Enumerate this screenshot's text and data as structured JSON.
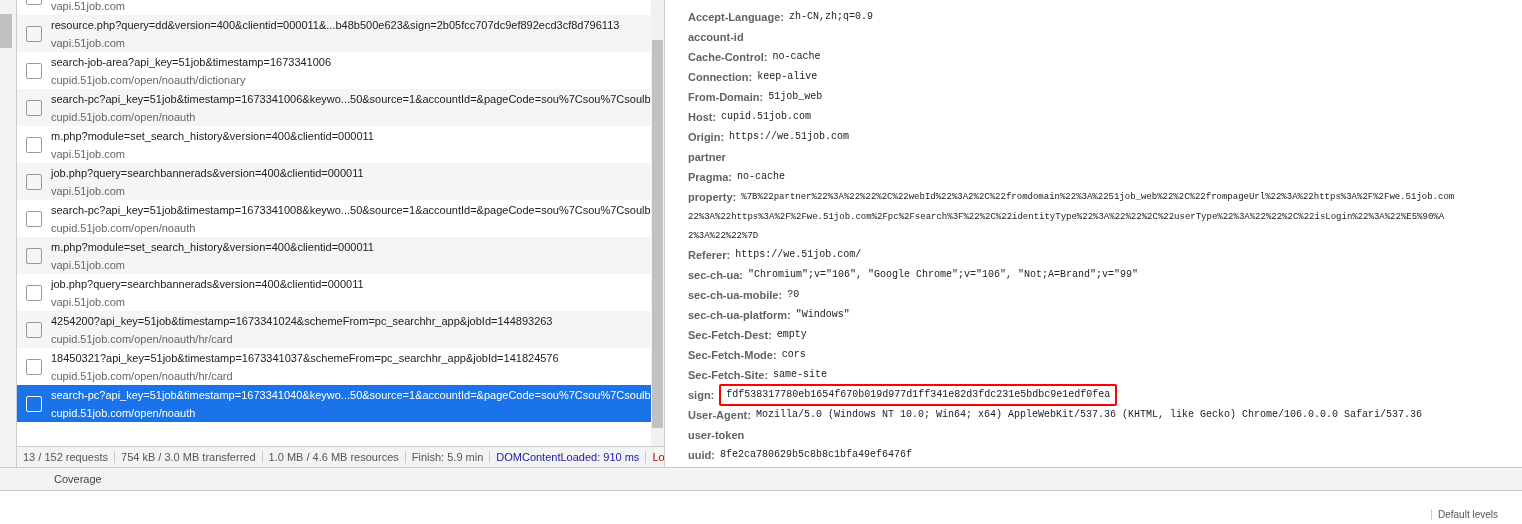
{
  "requests": [
    {
      "domain": "vapi.51job.com",
      "selected": false
    },
    {
      "name": "resource.php?query=dd&version=400&clientid=000011&...b48b500e623&sign=2b05fcc707dc9ef892ecd3cf8d796113",
      "domain": "vapi.51job.com",
      "selected": false
    },
    {
      "name": "search-job-area?api_key=51job&timestamp=1673341006",
      "domain": "cupid.51job.com/open/noauth/dictionary",
      "selected": false
    },
    {
      "name": "search-pc?api_key=51job&timestamp=1673341006&keywo...50&source=1&accountId=&pageCode=sou%7Csou%7Csoulb",
      "domain": "cupid.51job.com/open/noauth",
      "selected": false
    },
    {
      "name": "m.php?module=set_search_history&version=400&clientid=000011",
      "domain": "vapi.51job.com",
      "selected": false
    },
    {
      "name": "job.php?query=searchbannerads&version=400&clientid=000011",
      "domain": "vapi.51job.com",
      "selected": false
    },
    {
      "name": "search-pc?api_key=51job&timestamp=1673341008&keywo...50&source=1&accountId=&pageCode=sou%7Csou%7Csoulb",
      "domain": "cupid.51job.com/open/noauth",
      "selected": false
    },
    {
      "name": "m.php?module=set_search_history&version=400&clientid=000011",
      "domain": "vapi.51job.com",
      "selected": false
    },
    {
      "name": "job.php?query=searchbannerads&version=400&clientid=000011",
      "domain": "vapi.51job.com",
      "selected": false
    },
    {
      "name": "4254200?api_key=51job&timestamp=1673341024&schemeFrom=pc_searchhr_app&jobId=144893263",
      "domain": "cupid.51job.com/open/noauth/hr/card",
      "selected": false
    },
    {
      "name": "18450321?api_key=51job&timestamp=1673341037&schemeFrom=pc_searchhr_app&jobId=141824576",
      "domain": "cupid.51job.com/open/noauth/hr/card",
      "selected": false
    },
    {
      "name": "search-pc?api_key=51job&timestamp=1673341040&keywo...50&source=1&accountId=&pageCode=sou%7Csou%7Csoulb",
      "domain": "cupid.51job.com/open/noauth",
      "selected": true
    }
  ],
  "status_bar": [
    {
      "text": "13 / 152 requests",
      "kind": "plain"
    },
    {
      "text": "754 kB / 3.0 MB transferred",
      "kind": "plain"
    },
    {
      "text": "1.0 MB / 4.6 MB resources",
      "kind": "plain"
    },
    {
      "text": "Finish: 5.9 min",
      "kind": "plain"
    },
    {
      "text": "DOMContentLoaded: 910 ms",
      "kind": "dom"
    },
    {
      "text": "Lo",
      "kind": "load"
    }
  ],
  "headers": [
    {
      "name": "Accept-Language:",
      "value": [
        "zh-CN,zh;q=0.9"
      ]
    },
    {
      "name": "account-id"
    },
    {
      "name": "Cache-Control:",
      "value": [
        "no-cache"
      ]
    },
    {
      "name": "Connection:",
      "value": [
        "keep-alive"
      ]
    },
    {
      "name": "From-Domain:",
      "value": [
        "51job_web"
      ]
    },
    {
      "name": "Host:",
      "value": [
        "cupid.51job.com"
      ]
    },
    {
      "name": "Origin:",
      "value": [
        "https://we.51job.com"
      ]
    },
    {
      "name": "partner"
    },
    {
      "name": "Pragma:",
      "value": [
        "no-cache"
      ]
    },
    {
      "name": "property:",
      "value": [
        "%7B%22partner%22%3A%22%22%2C%22webId%22%3A2%2C%22fromdomain%22%3A%2251job_web%22%2C%22frompageUrl%22%3A%22https%3A%2F%2Fwe.51job.com",
        "22%3A%22https%3A%2F%2Fwe.51job.com%2Fpc%2Fsearch%3F%22%2C%22identityType%22%3A%22%22%2C%22userType%22%3A%22%22%2C%22isLogin%22%3A%22%E5%90%A",
        "2%3A%22%22%7D"
      ]
    },
    {
      "name": "Referer:",
      "value": [
        "https://we.51job.com/"
      ]
    },
    {
      "name": "sec-ch-ua:",
      "value": [
        "\"Chromium\";v=\"106\", \"Google Chrome\";v=\"106\", \"Not;A=Brand\";v=\"99\""
      ]
    },
    {
      "name": "sec-ch-ua-mobile:",
      "value": [
        "?0"
      ]
    },
    {
      "name": "sec-ch-ua-platform:",
      "value": [
        "\"Windows\""
      ]
    },
    {
      "name": "Sec-Fetch-Dest:",
      "value": [
        "empty"
      ]
    },
    {
      "name": "Sec-Fetch-Mode:",
      "value": [
        "cors"
      ]
    },
    {
      "name": "Sec-Fetch-Site:",
      "value": [
        "same-site"
      ]
    },
    {
      "name": "sign:",
      "value": [
        "fdf538317780eb1654f670b019d977d1ff341e82d3fdc231e5bdbc9e1edf0fea"
      ],
      "highlighted": true
    },
    {
      "name": "User-Agent:",
      "value": [
        "Mozilla/5.0 (Windows NT 10.0; Win64; x64) AppleWebKit/537.36 (KHTML, like Gecko) Chrome/106.0.0.0 Safari/537.36"
      ]
    },
    {
      "name": "user-token"
    },
    {
      "name": "uuid:",
      "value": [
        "8fe2ca780629b5c8b8c1bfa49ef6476f"
      ]
    }
  ],
  "drawer": {
    "tab": "Coverage",
    "levels": "Default levels"
  }
}
